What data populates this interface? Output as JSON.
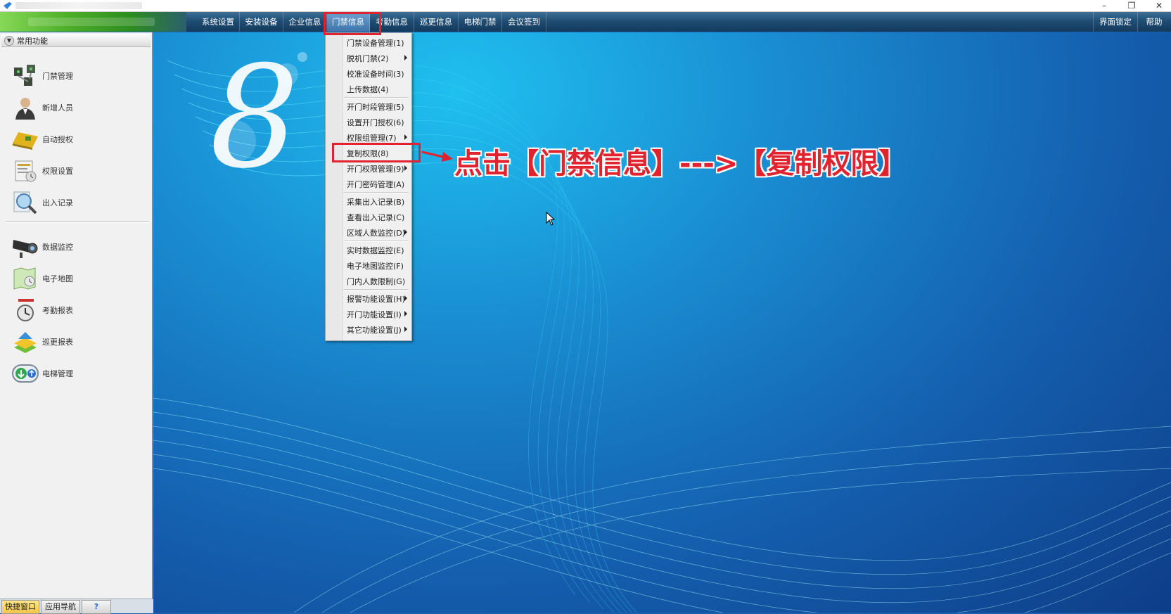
{
  "window": {
    "controls": {
      "minimize": "–",
      "restore": "❐",
      "close": "✕"
    }
  },
  "menubar": {
    "items": [
      {
        "label": "系统设置"
      },
      {
        "label": "安装设备"
      },
      {
        "label": "企业信息"
      },
      {
        "label": "门禁信息"
      },
      {
        "label": "考勤信息"
      },
      {
        "label": "巡更信息"
      },
      {
        "label": "电梯门禁"
      },
      {
        "label": "会议签到"
      }
    ],
    "right": [
      {
        "label": "界面锁定"
      },
      {
        "label": "帮助"
      }
    ]
  },
  "left_panel": {
    "header": "常用功能",
    "items": [
      {
        "label": "门禁管理",
        "icon": "door-control-icon"
      },
      {
        "label": "新增人员",
        "icon": "add-person-icon"
      },
      {
        "label": "自动授权",
        "icon": "auto-authorize-icon"
      },
      {
        "label": "权限设置",
        "icon": "permission-settings-icon"
      },
      {
        "label": "出入记录",
        "icon": "access-record-icon"
      },
      {
        "label": "数据监控",
        "icon": "camera-monitor-icon"
      },
      {
        "label": "电子地图",
        "icon": "electronic-map-icon"
      },
      {
        "label": "考勤报表",
        "icon": "attendance-report-icon"
      },
      {
        "label": "巡更报表",
        "icon": "patrol-report-icon"
      },
      {
        "label": "电梯管理",
        "icon": "elevator-icon"
      }
    ]
  },
  "bottom_tabs": [
    {
      "label": "快捷窗口"
    },
    {
      "label": "应用导航"
    },
    {
      "label": "?"
    }
  ],
  "dropdown": {
    "items": [
      {
        "label": "门禁设备管理(1)",
        "submenu": false
      },
      {
        "label": "脱机门禁(2)",
        "submenu": true
      },
      {
        "label": "校准设备时间(3)",
        "submenu": false
      },
      {
        "label": "上传数据(4)",
        "submenu": false
      },
      {
        "label": "开门时段管理(5)",
        "submenu": false
      },
      {
        "label": "设置开门授权(6)",
        "submenu": false
      },
      {
        "label": "权限组管理(7)",
        "submenu": true
      },
      {
        "label": "复制权限(8)",
        "submenu": false
      },
      {
        "label": "开门权限管理(9)",
        "submenu": true
      },
      {
        "label": "开门密码管理(A)",
        "submenu": false
      },
      {
        "label": "采集出入记录(B)",
        "submenu": false
      },
      {
        "label": "查看出入记录(C)",
        "submenu": false
      },
      {
        "label": "区域人数监控(D)",
        "submenu": true
      },
      {
        "label": "实时数据监控(E)",
        "submenu": false
      },
      {
        "label": "电子地图监控(F)",
        "submenu": false
      },
      {
        "label": "门内人数限制(G)",
        "submenu": false
      },
      {
        "label": "报警功能设置(H)",
        "submenu": true
      },
      {
        "label": "开门功能设置(I)",
        "submenu": true
      },
      {
        "label": "其它功能设置(J)",
        "submenu": true
      }
    ]
  },
  "annotation": {
    "text": "点击【门禁信息】--->【复制权限】",
    "color": "#e0232e"
  },
  "colors": {
    "accent_red": "#e0232e",
    "menubar_dark": "#14395c",
    "brand_green": "#4fb02a",
    "main_blue": "#145fae"
  }
}
